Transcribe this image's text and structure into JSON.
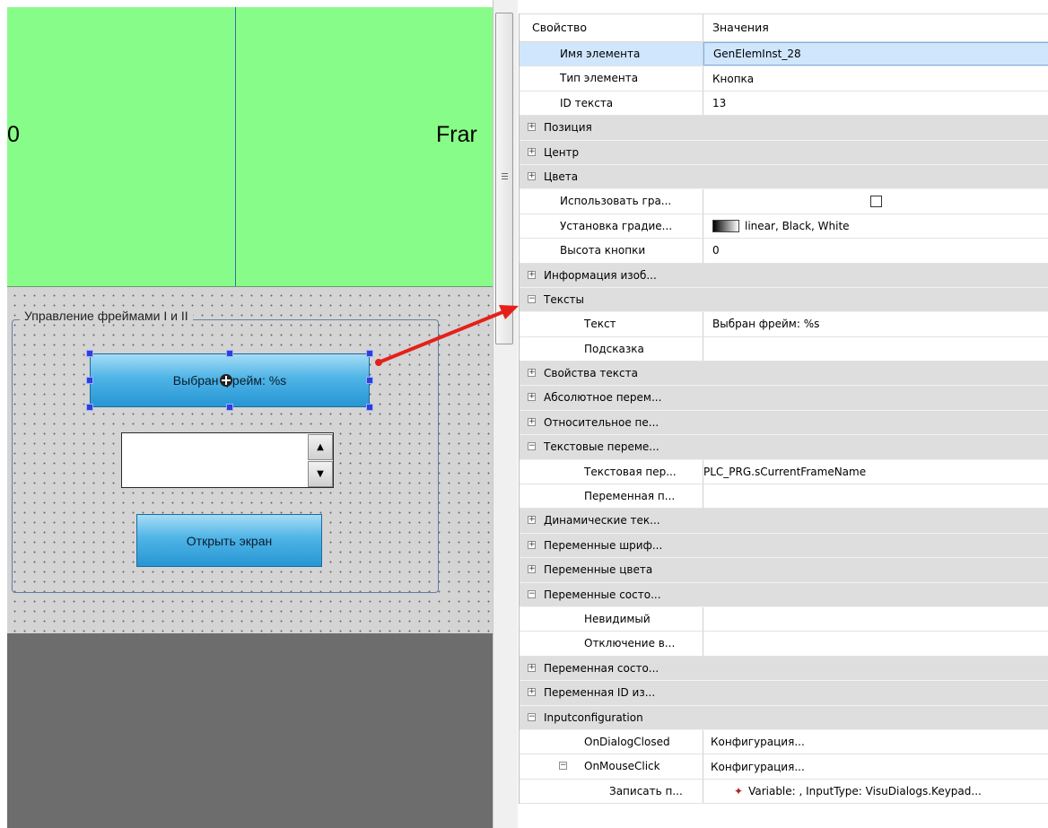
{
  "canvas": {
    "frame_left_text": "0",
    "frame_right_text": "Frar",
    "group_title": "Управление фреймами I и II",
    "selected_button_text": "Выбран фрейм: %s",
    "open_button_text": "Открыть экран",
    "spin_up_icon": "triangle-up-icon",
    "spin_down_icon": "triangle-down-icon"
  },
  "grid": {
    "header": {
      "property": "Свойство",
      "values": "Значения"
    },
    "rows": [
      {
        "label": "Имя элемента",
        "value": "GenElemInst_28"
      },
      {
        "label": "Тип элемента",
        "value": "Кнопка"
      },
      {
        "label": "ID текста",
        "value": "13"
      },
      {
        "label": "Позиция",
        "value": ""
      },
      {
        "label": "Центр",
        "value": ""
      },
      {
        "label": "Цвета",
        "value": ""
      },
      {
        "label": "Использовать гра...",
        "value": ""
      },
      {
        "label": "Установка градие...",
        "value": "linear, Black, White"
      },
      {
        "label": "Высота кнопки",
        "value": "0"
      },
      {
        "label": "Информация изоб...",
        "value": ""
      },
      {
        "label": "Тексты",
        "value": ""
      },
      {
        "label": "Текст",
        "value": "Выбран фрейм: %s"
      },
      {
        "label": "Подсказка",
        "value": ""
      },
      {
        "label": "Свойства текста",
        "value": ""
      },
      {
        "label": "Абсолютное перем...",
        "value": ""
      },
      {
        "label": "Относительное пе...",
        "value": ""
      },
      {
        "label": "Текстовые переме...",
        "value": ""
      },
      {
        "label": "Текстовая пер...",
        "value": "PLC_PRG.sCurrentFrameName"
      },
      {
        "label": "Переменная п...",
        "value": ""
      },
      {
        "label": "Динамические тек...",
        "value": ""
      },
      {
        "label": "Переменные шриф...",
        "value": ""
      },
      {
        "label": "Переменные цвета",
        "value": ""
      },
      {
        "label": "Переменные состо...",
        "value": ""
      },
      {
        "label": "Невидимый",
        "value": ""
      },
      {
        "label": "Отключение в...",
        "value": ""
      },
      {
        "label": "Переменная состо...",
        "value": ""
      },
      {
        "label": "Переменная ID из...",
        "value": ""
      },
      {
        "label": "Inputconfiguration",
        "value": ""
      },
      {
        "label": "OnDialogClosed",
        "value": "Конфигурация..."
      },
      {
        "label": "OnMouseClick",
        "value": "Конфигурация..."
      },
      {
        "label": "Записать п...",
        "value": "Variable: , InputType: VisuDialogs.Keypad..."
      }
    ],
    "expander_plus": "+",
    "expander_minus": "−"
  },
  "colors": {
    "frame_green": "#88fc88",
    "button_blue": "#2796d4",
    "selection_blue": "#cfe6fc",
    "arrow_red": "#e5201a"
  }
}
